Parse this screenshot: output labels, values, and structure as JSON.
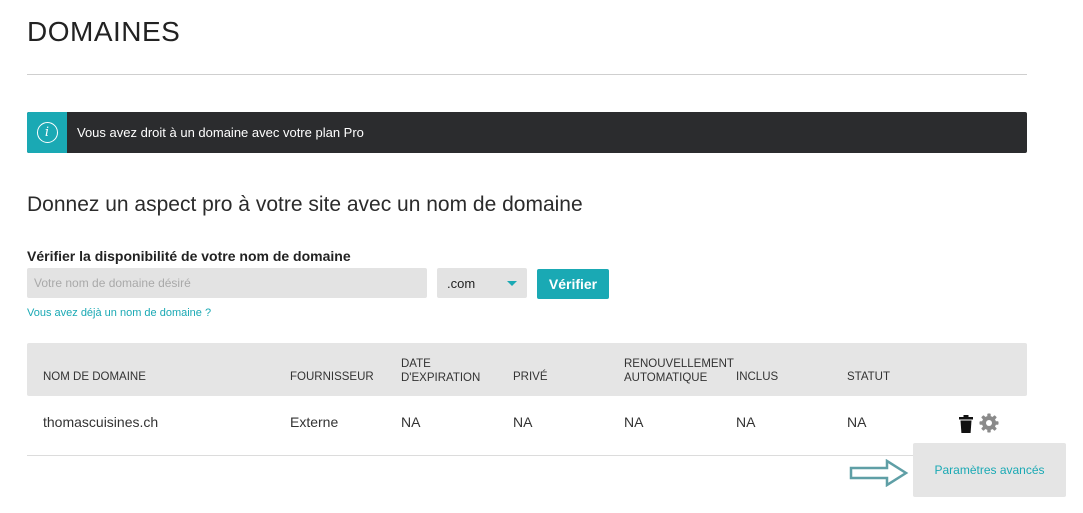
{
  "page": {
    "title": "DOMAINES"
  },
  "banner": {
    "icon": "info-icon",
    "text": "Vous avez droit à un domaine avec votre plan Pro",
    "colors": {
      "background": "#2b2c2e",
      "icon_bg": "#1aa9b4"
    }
  },
  "search": {
    "heading": "Donnez un aspect pro à votre site avec un nom de domaine",
    "label": "Vérifier la disponibilité de votre nom de domaine",
    "placeholder": "Votre nom de domaine désiré",
    "value": "",
    "tld_selected": ".com",
    "button": "Vérifier",
    "own_domain_link": "Vous avez déjà un nom de domaine ?"
  },
  "table": {
    "headers": {
      "domain": "NOM DE DOMAINE",
      "provider": "FOURNISSEUR",
      "expiration_line1": "DATE",
      "expiration_line2": "D'EXPIRATION",
      "private": "PRIVÉ",
      "renewal_line1": "RENOUVELLEMENT",
      "renewal_line2": "AUTOMATIQUE",
      "included": "INCLUS",
      "status": "STATUT"
    },
    "rows": [
      {
        "domain": "thomascuisines.ch",
        "provider": "Externe",
        "expiration": "NA",
        "private": "NA",
        "renewal": "NA",
        "included": "NA",
        "status": "NA",
        "actions": [
          "trash-icon",
          "gear-icon"
        ]
      }
    ]
  },
  "popover": {
    "link": "Paramètres avancés"
  },
  "colors": {
    "accent": "#1aa9b4",
    "header_bg": "#e5e5e5",
    "input_bg": "#e3e3e3"
  }
}
